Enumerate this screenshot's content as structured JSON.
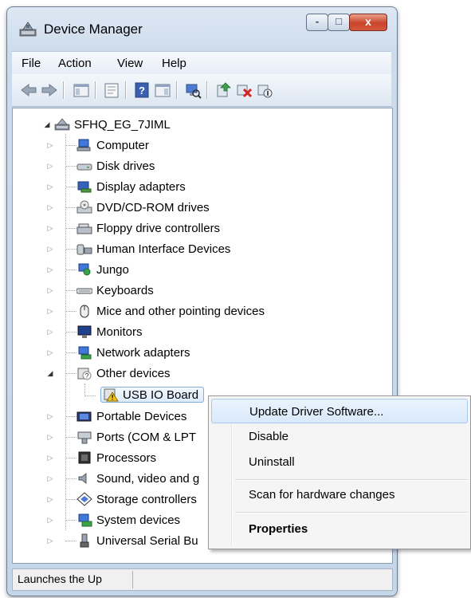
{
  "window": {
    "title": "Device Manager",
    "controls": {
      "minimize": "-",
      "maximize": "□",
      "close": "x"
    }
  },
  "menu": [
    "File",
    "Action",
    "View",
    "Help"
  ],
  "toolbar": [
    "back-icon",
    "forward-icon",
    "show-hide-console-tree-icon",
    "properties-icon",
    "help-icon",
    "action-pane-icon",
    "scan-hardware-icon",
    "update-driver-icon",
    "uninstall-icon",
    "disable-icon"
  ],
  "tree": {
    "root": "SFHQ_EG_7JIML",
    "categories": [
      {
        "label": "Computer",
        "icon": "computer-icon"
      },
      {
        "label": "Disk drives",
        "icon": "disk-drive-icon"
      },
      {
        "label": "Display adapters",
        "icon": "display-adapter-icon"
      },
      {
        "label": "DVD/CD-ROM drives",
        "icon": "dvd-drive-icon"
      },
      {
        "label": "Floppy drive controllers",
        "icon": "floppy-controller-icon"
      },
      {
        "label": "Human Interface Devices",
        "icon": "hid-icon"
      },
      {
        "label": "Jungo",
        "icon": "jungo-icon"
      },
      {
        "label": "Keyboards",
        "icon": "keyboard-icon"
      },
      {
        "label": "Mice and other pointing devices",
        "icon": "mouse-icon"
      },
      {
        "label": "Monitors",
        "icon": "monitor-icon"
      },
      {
        "label": "Network adapters",
        "icon": "network-adapter-icon"
      },
      {
        "label": "Other devices",
        "icon": "other-devices-icon",
        "expanded": true
      },
      {
        "label": "USB IO Board",
        "icon": "warning-device-icon",
        "child": true,
        "selected": true
      },
      {
        "label": "Portable Devices",
        "icon": "portable-device-icon"
      },
      {
        "label": "Ports (COM & LPT",
        "icon": "port-icon"
      },
      {
        "label": "Processors",
        "icon": "processor-icon"
      },
      {
        "label": "Sound, video and g",
        "icon": "sound-icon"
      },
      {
        "label": "Storage controllers",
        "icon": "storage-controller-icon"
      },
      {
        "label": "System devices",
        "icon": "system-device-icon"
      },
      {
        "label": "Universal Serial Bu",
        "icon": "usb-icon"
      }
    ]
  },
  "context_menu": {
    "items": [
      {
        "label": "Update Driver Software...",
        "highlighted": true
      },
      {
        "label": "Disable"
      },
      {
        "label": "Uninstall"
      },
      {
        "label": "Scan for hardware changes"
      },
      {
        "label": "Properties",
        "bold": true
      }
    ]
  },
  "status_bar": {
    "text": "Launches the Up"
  }
}
